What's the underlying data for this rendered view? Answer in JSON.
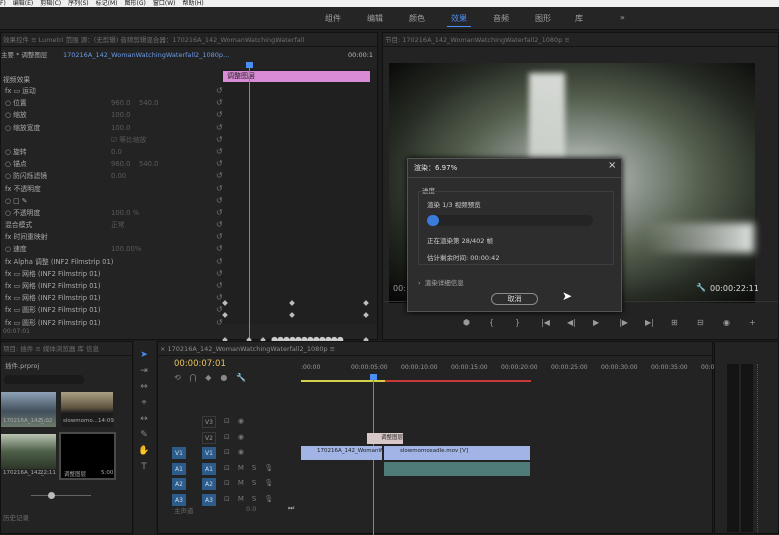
{
  "menubar": [
    "F)",
    "编辑(E)",
    "剪辑(C)",
    "序列(S)",
    "标记(M)",
    "图形(G)",
    "窗口(W)",
    "帮助(H)"
  ],
  "workspaces": {
    "items": [
      "组件",
      "编辑",
      "颜色",
      "效果",
      "音频",
      "图形",
      "库"
    ],
    "active": "效果",
    "more": "»"
  },
  "effect_controls": {
    "tabs": "效果控件 ≡   Lumetri 范围    源：(无剪辑)    音频剪辑混合器：170216A_142_WomanWatchingWaterfall",
    "clip_header": "主要 * 调整图层",
    "sequence_clip": "170216A_142_WomanWatchingWaterfall2_1080p...",
    "time_label": "00:00:1",
    "layer_clip": "调整图层",
    "section_video": "视频效果",
    "rows": [
      {
        "k": "fx  ▭  运动",
        "v": "",
        "v2": ""
      },
      {
        "k": "   ○ 位置",
        "v": "960.0",
        "v2": "540.0"
      },
      {
        "k": "   ○ 缩放",
        "v": "100.0",
        "v2": ""
      },
      {
        "k": "   ○ 缩放宽度",
        "v": "100.0",
        "v2": ""
      },
      {
        "k": "",
        "v": "☑ 等比缩放",
        "v2": ""
      },
      {
        "k": "   ○ 旋转",
        "v": "0.0",
        "v2": ""
      },
      {
        "k": "   ○ 锚点",
        "v": "960.0",
        "v2": "540.0"
      },
      {
        "k": "   ○ 防闪烁滤镜",
        "v": "0.00",
        "v2": ""
      },
      {
        "k": "fx  不透明度",
        "v": "",
        "v2": ""
      },
      {
        "k": "     ○  □  ✎",
        "v": "",
        "v2": ""
      },
      {
        "k": "   ○ 不透明度",
        "v": "100.0 %",
        "v2": ""
      },
      {
        "k": "     混合模式",
        "v": "正常",
        "v2": ""
      },
      {
        "k": "fx  时间重映射",
        "v": "",
        "v2": ""
      },
      {
        "k": "   ○ 速度",
        "v": "100.00%",
        "v2": ""
      },
      {
        "k": "fx  Alpha 调整 (INF2 Filmstrip 01)",
        "v": "",
        "v2": ""
      },
      {
        "k": "fx  ▭  网格 (INF2 Filmstrip 01)",
        "v": "",
        "v2": ""
      },
      {
        "k": "fx  ▭  网格 (INF2 Filmstrip 01)",
        "v": "",
        "v2": ""
      },
      {
        "k": "fx  ▭  网格 (INF2 Filmstrip 01)",
        "v": "",
        "v2": ""
      },
      {
        "k": "fx  ▭  圆形 (INF2 Filmstrip 01)",
        "v": "",
        "v2": ""
      },
      {
        "k": "fx  ▭  圆形 (INF2 Filmstrip 01)",
        "v": "",
        "v2": ""
      }
    ],
    "footer_time": "00:07:01"
  },
  "program_monitor": {
    "tab": "节目: 170216A_142_WomanWatchingWaterfall2_1080p ≡",
    "time_left": "00:",
    "time_right": "00:00:22:11",
    "transport": [
      "⬢",
      "{",
      "}",
      "|◀",
      "◀|",
      "▶",
      "|▶",
      "▶|",
      "⊞",
      "⊟",
      "◉",
      "+"
    ]
  },
  "render_dialog": {
    "title": "渲染：6.97%",
    "close": "×",
    "progress_label": "进度",
    "task": "渲染 1/3 视频预览",
    "progress_fraction": 0.0697,
    "frame_status": "正在渲染第 28/402 帧",
    "time_remaining": "估计剩余时间: 00:00:42",
    "details": "渲染详细信息",
    "cancel": "取消"
  },
  "project_panel": {
    "tabs": "项目: 插件 ≡    媒体浏览器    库    信息",
    "name": "插件.prproj",
    "items": [
      {
        "name": "170216A_142_...",
        "dur": "5:02"
      },
      {
        "name": "slowmomo...",
        "dur": "14:09"
      },
      {
        "name": "170216A_142_...",
        "dur": "22:11"
      },
      {
        "name": "调整图层",
        "dur": "5:00"
      }
    ],
    "bottom_tab": "历史记录"
  },
  "timeline": {
    "tab": "× 170216A_142_WomanWatchingWaterfall2_1080p ≡",
    "timecode": "00:00:07:01",
    "ruler": [
      ":00:00",
      "00:00:05:00",
      "00:00:10:00",
      "00:00:15:00",
      "00:00:20:00",
      "00:00:25:00",
      "00:00:30:00",
      "00:00:35:00",
      "00:00"
    ],
    "tracks": [
      {
        "id": "V3",
        "src": ""
      },
      {
        "id": "V2",
        "src": ""
      },
      {
        "id": "V1",
        "src": "V1"
      },
      {
        "id": "A1",
        "src": "A1"
      },
      {
        "id": "A2",
        "src": "A2"
      },
      {
        "id": "A3",
        "src": "A3"
      }
    ],
    "master": "主声道",
    "master_val": "0.0",
    "clip_adjust": "调整图层",
    "clip_v1": "170216A_142_WomanWatchingWater",
    "clip_v1b": "slowmomoxadle.mov [V]"
  },
  "colors": {
    "accent": "#4a8ff7",
    "pink": "#d98bd5",
    "clip_v": "#a2b4e6"
  }
}
